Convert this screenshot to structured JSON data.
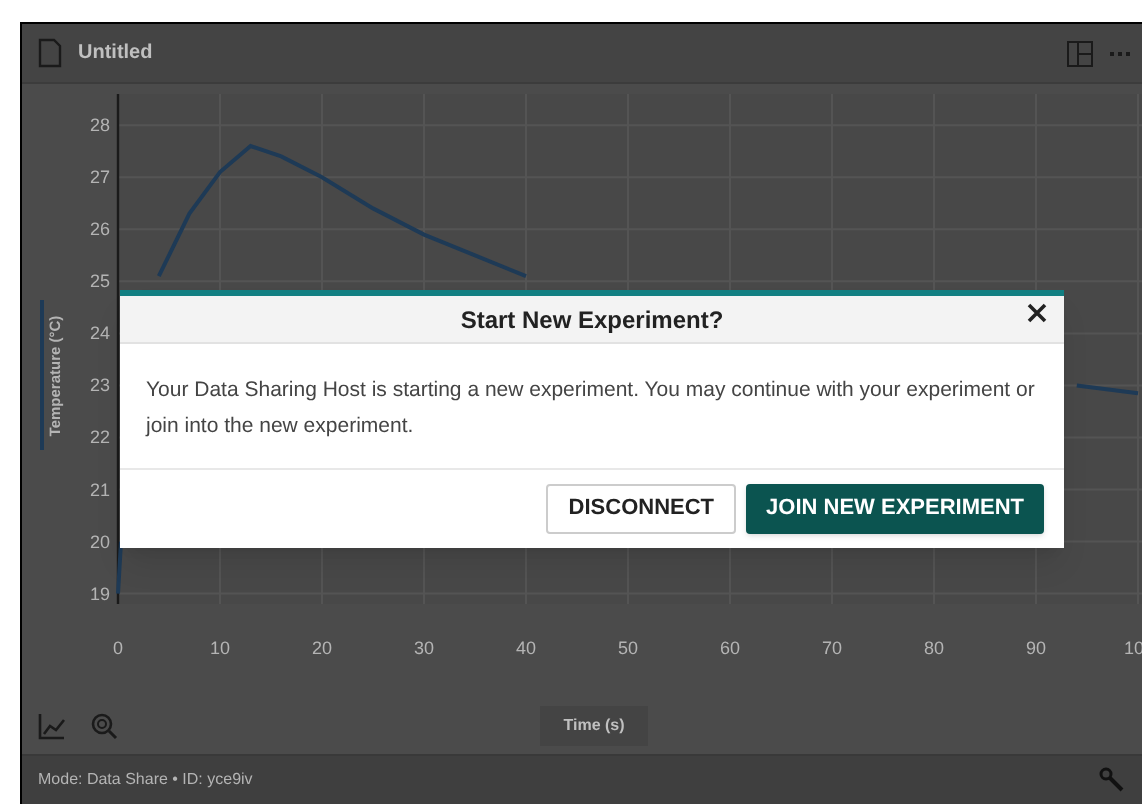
{
  "window": {
    "title": "Untitled"
  },
  "chart": {
    "chart_data": {
      "type": "line",
      "grid": true,
      "xlabel": "Time (s)",
      "ylabel": "Temperature (°C)",
      "xlim": [
        0,
        100
      ],
      "ylim": [
        18.8,
        28.6
      ],
      "xticks": [
        0,
        10,
        20,
        30,
        40,
        50,
        60,
        70,
        80,
        90
      ],
      "yticks": [
        19,
        20,
        21,
        22,
        23,
        24,
        25,
        26,
        27,
        28
      ],
      "x": [
        0,
        0.3,
        1,
        4,
        7,
        10,
        13,
        16,
        20,
        25,
        30,
        35,
        40,
        60,
        94,
        100
      ],
      "series": [
        {
          "color": "#1e3a56",
          "values": [
            19,
            20,
            null,
            25.1,
            26.3,
            27.1,
            27.6,
            27.4,
            27,
            26.4,
            25.9,
            25.5,
            25.1,
            null,
            23,
            22.85
          ]
        }
      ]
    },
    "x_tick_cut_at_edge": "10"
  },
  "status_bar": {
    "text": "Mode: Data Share • ID: yce9iv"
  },
  "dialog": {
    "title": "Start New Experiment?",
    "message": "Your Data Sharing Host is starting a new experiment. You may continue with your experiment or join into the new experiment.",
    "buttons": [
      {
        "label": "DISCONNECT",
        "kind": "secondary"
      },
      {
        "label": "JOIN NEW EXPERIMENT",
        "kind": "primary"
      }
    ]
  }
}
